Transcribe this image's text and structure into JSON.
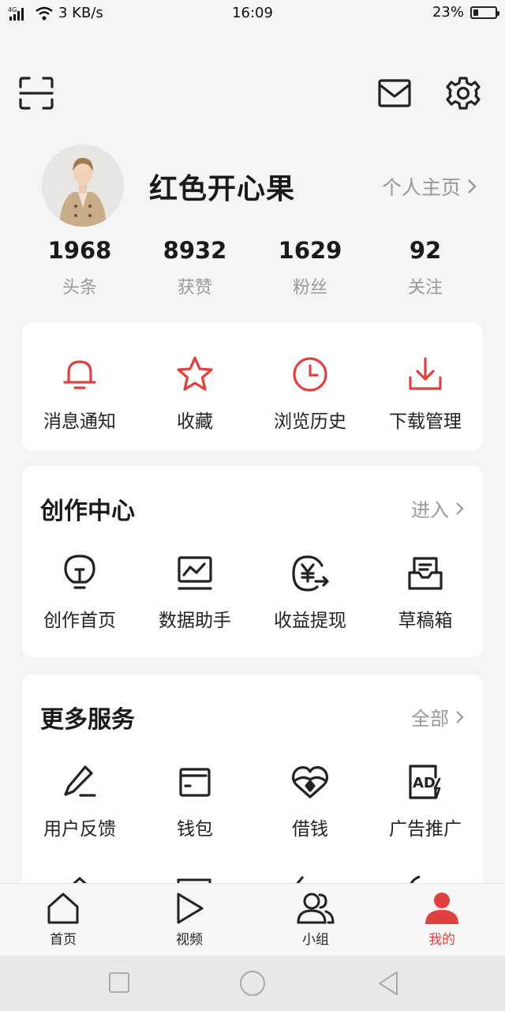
{
  "status_bar": {
    "network": "4G",
    "speed": "3 KB/s",
    "time": "16:09",
    "battery": "23%",
    "battery_level": 0.23
  },
  "header": {
    "scan_icon": "scan-icon",
    "mail_icon": "mail-icon",
    "settings_icon": "gear-icon"
  },
  "profile": {
    "username": "红色开心果",
    "homepage_link": "个人主页"
  },
  "stats": [
    {
      "value": "1968",
      "label": "头条"
    },
    {
      "value": "8932",
      "label": "获赞"
    },
    {
      "value": "1629",
      "label": "粉丝"
    },
    {
      "value": "92",
      "label": "关注"
    }
  ],
  "quick_actions": [
    {
      "label": "消息通知",
      "icon": "bell-icon"
    },
    {
      "label": "收藏",
      "icon": "star-icon"
    },
    {
      "label": "浏览历史",
      "icon": "clock-icon"
    },
    {
      "label": "下载管理",
      "icon": "download-icon"
    }
  ],
  "creation_center": {
    "title": "创作中心",
    "more": "进入",
    "items": [
      {
        "label": "创作首页",
        "icon": "lightbulb-icon"
      },
      {
        "label": "数据助手",
        "icon": "chart-icon"
      },
      {
        "label": "收益提现",
        "icon": "yuan-icon"
      },
      {
        "label": "草稿箱",
        "icon": "inbox-icon"
      }
    ]
  },
  "more_services": {
    "title": "更多服务",
    "more": "全部",
    "items": [
      {
        "label": "用户反馈",
        "icon": "pencil-icon"
      },
      {
        "label": "钱包",
        "icon": "wallet-icon"
      },
      {
        "label": "借钱",
        "icon": "loan-icon"
      },
      {
        "label": "广告推广",
        "icon": "ad-icon"
      }
    ]
  },
  "tab_bar": [
    {
      "label": "首页",
      "icon": "home-icon"
    },
    {
      "label": "视频",
      "icon": "play-icon"
    },
    {
      "label": "小组",
      "icon": "group-icon"
    },
    {
      "label": "我的",
      "icon": "person-icon",
      "active": true
    }
  ],
  "colors": {
    "accent": "#e0403f",
    "background": "#f5f5f5"
  }
}
